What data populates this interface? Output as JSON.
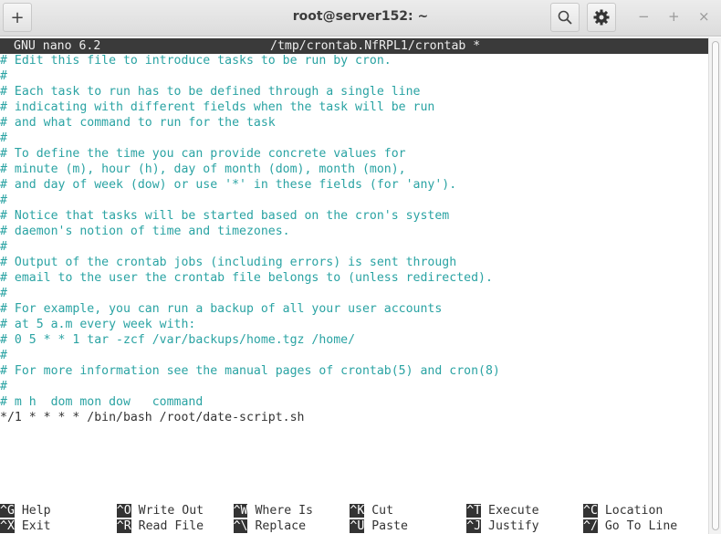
{
  "window": {
    "title": "root@server152: ~",
    "new_tab": "+",
    "minimize": "−",
    "maximize": "+",
    "close": "×"
  },
  "nano": {
    "version": "GNU nano 6.2",
    "file": "/tmp/crontab.NfRPL1/crontab *"
  },
  "lines": [
    "# Edit this file to introduce tasks to be run by cron.",
    "#",
    "# Each task to run has to be defined through a single line",
    "# indicating with different fields when the task will be run",
    "# and what command to run for the task",
    "#",
    "# To define the time you can provide concrete values for",
    "# minute (m), hour (h), day of month (dom), month (mon),",
    "# and day of week (dow) or use '*' in these fields (for 'any').",
    "#",
    "# Notice that tasks will be started based on the cron's system",
    "# daemon's notion of time and timezones.",
    "#",
    "# Output of the crontab jobs (including errors) is sent through",
    "# email to the user the crontab file belongs to (unless redirected).",
    "#",
    "# For example, you can run a backup of all your user accounts",
    "# at 5 a.m every week with:",
    "# 0 5 * * 1 tar -zcf /var/backups/home.tgz /home/",
    "#",
    "# For more information see the manual pages of crontab(5) and cron(8)",
    "#",
    "# m h  dom mon dow   command",
    "*/1 * * * * /bin/bash /root/date-script.sh"
  ],
  "shortcuts": [
    [
      {
        "key": "^G",
        "label": "Help"
      },
      {
        "key": "^O",
        "label": "Write Out"
      },
      {
        "key": "^W",
        "label": "Where Is"
      },
      {
        "key": "^K",
        "label": "Cut"
      },
      {
        "key": "^T",
        "label": "Execute"
      },
      {
        "key": "^C",
        "label": "Location"
      }
    ],
    [
      {
        "key": "^X",
        "label": "Exit"
      },
      {
        "key": "^R",
        "label": "Read File"
      },
      {
        "key": "^\\",
        "label": "Replace"
      },
      {
        "key": "^U",
        "label": "Paste"
      },
      {
        "key": "^J",
        "label": "Justify"
      },
      {
        "key": "^/",
        "label": "Go To Line"
      }
    ]
  ]
}
